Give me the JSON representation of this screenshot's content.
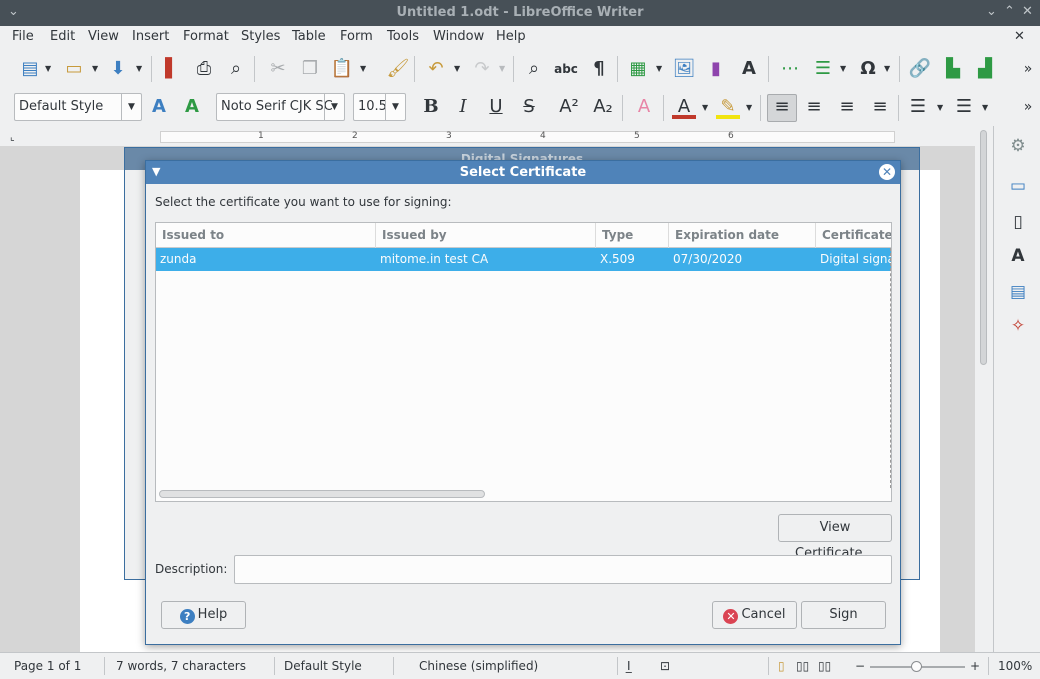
{
  "window": {
    "title": "Untitled 1.odt - LibreOffice Writer"
  },
  "menubar": [
    "File",
    "Edit",
    "View",
    "Insert",
    "Format",
    "Styles",
    "Table",
    "Form",
    "Tools",
    "Window",
    "Help"
  ],
  "formatting": {
    "paragraph_style": "Default Style",
    "font_name": "Noto Serif CJK SC",
    "font_size": "10.5"
  },
  "back_dialog": {
    "title": "Digital Signatures"
  },
  "dialog": {
    "title": "Select Certificate",
    "prompt": "Select the certificate you want to use for signing:",
    "columns": [
      "Issued to",
      "Issued by",
      "Type",
      "Expiration date",
      "Certificate u"
    ],
    "rows": [
      {
        "issued_to": "zunda",
        "issued_by": "mitome.in test CA",
        "type": "X.509",
        "expiration": "07/30/2020",
        "usage": "Digital signat"
      }
    ],
    "view_certificate_label": "View Certificate...",
    "description_label": "Description:",
    "description_value": "",
    "help_label": "Help",
    "cancel_label": "Cancel",
    "sign_label": "Sign"
  },
  "statusbar": {
    "page": "Page 1 of 1",
    "words": "7 words, 7 characters",
    "style": "Default Style",
    "language": "Chinese (simplified)",
    "zoom": "100%"
  },
  "colors": {
    "accent": "#3daee9",
    "titlebar_active": "#4f83b9"
  }
}
